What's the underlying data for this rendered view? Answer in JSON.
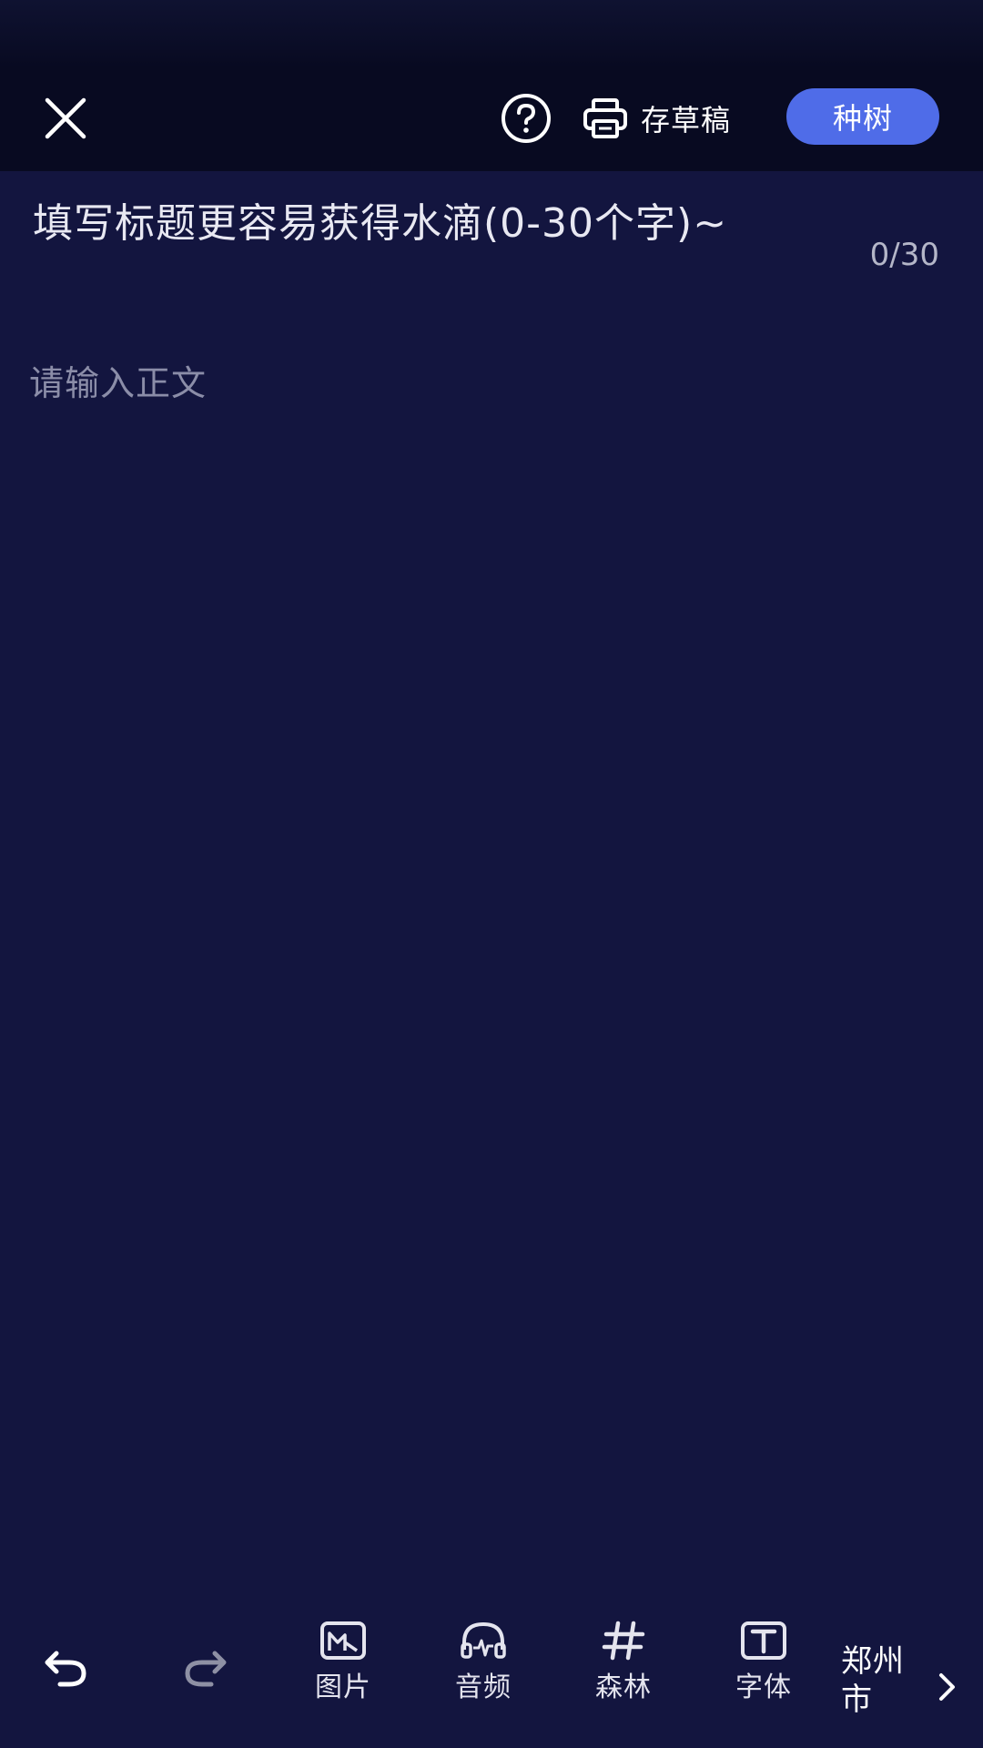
{
  "header": {
    "draft_label": "存草稿",
    "plant_label": "种树"
  },
  "title_input": {
    "placeholder": "填写标题更容易获得水滴(0-30个字)~",
    "counter": "0/30"
  },
  "body_input": {
    "placeholder": "请输入正文"
  },
  "toolbar": {
    "tools": [
      {
        "label": "图片",
        "icon": "image-icon"
      },
      {
        "label": "音频",
        "icon": "headphones-icon"
      },
      {
        "label": "森林",
        "icon": "hashtag-icon"
      },
      {
        "label": "字体",
        "icon": "font-icon"
      }
    ],
    "location": "郑州市"
  },
  "colors": {
    "background": "#13153f",
    "header_background": "#080a21",
    "accent": "#4f6ce8",
    "placeholder": "#8b8da8"
  }
}
